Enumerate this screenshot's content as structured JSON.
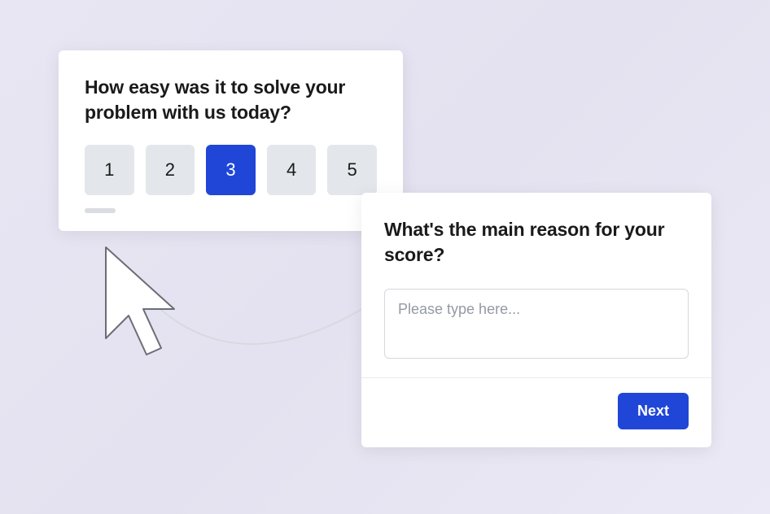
{
  "survey": {
    "rating": {
      "question": "How easy was it to solve your problem with us today?",
      "options": [
        "1",
        "2",
        "3",
        "4",
        "5"
      ],
      "selected": "3"
    },
    "reason": {
      "question": "What's the main reason for your score?",
      "placeholder": "Please type here...",
      "next_label": "Next"
    }
  },
  "colors": {
    "primary": "#2046d8",
    "neutral_btn": "#e3e6ea",
    "card_bg": "#ffffff"
  }
}
